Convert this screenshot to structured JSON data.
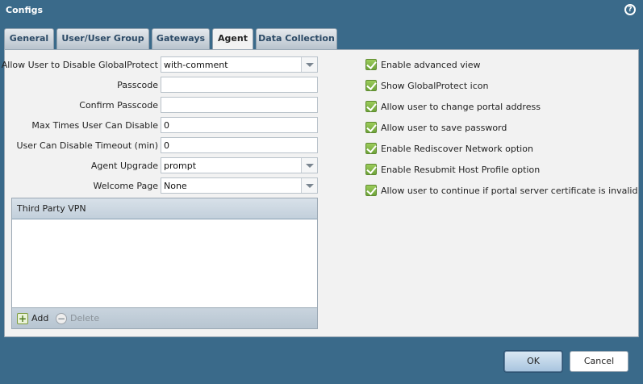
{
  "window": {
    "title": "Configs"
  },
  "tabs": [
    {
      "label": "General",
      "active": false
    },
    {
      "label": "User/User Group",
      "active": false
    },
    {
      "label": "Gateways",
      "active": false
    },
    {
      "label": "Agent",
      "active": true
    },
    {
      "label": "Data Collection",
      "active": false
    }
  ],
  "form": {
    "allow_disable": {
      "label": "Allow User to Disable GlobalProtect",
      "value": "with-comment"
    },
    "passcode": {
      "label": "Passcode",
      "value": ""
    },
    "confirm_passcode": {
      "label": "Confirm Passcode",
      "value": ""
    },
    "max_times": {
      "label": "Max Times User Can Disable",
      "value": "0"
    },
    "disable_timeout": {
      "label": "User Can Disable Timeout (min)",
      "value": "0"
    },
    "agent_upgrade": {
      "label": "Agent Upgrade",
      "value": "prompt"
    },
    "welcome_page": {
      "label": "Welcome Page",
      "value": "None"
    }
  },
  "third_party_vpn": {
    "header": "Third Party VPN",
    "add_label": "Add",
    "delete_label": "Delete"
  },
  "options": [
    {
      "label": "Enable advanced view",
      "checked": true
    },
    {
      "label": "Show GlobalProtect icon",
      "checked": true
    },
    {
      "label": "Allow user to change portal address",
      "checked": true
    },
    {
      "label": "Allow user to save password",
      "checked": true
    },
    {
      "label": "Enable Rediscover Network option",
      "checked": true
    },
    {
      "label": "Enable Resubmit Host Profile option",
      "checked": true
    },
    {
      "label": "Allow user to continue if portal server certificate is invalid",
      "checked": true
    }
  ],
  "buttons": {
    "ok": "OK",
    "cancel": "Cancel"
  },
  "colors": {
    "frame": "#3a6a8a",
    "checkbox": "#7db246",
    "panel": "#f2f2f2"
  }
}
